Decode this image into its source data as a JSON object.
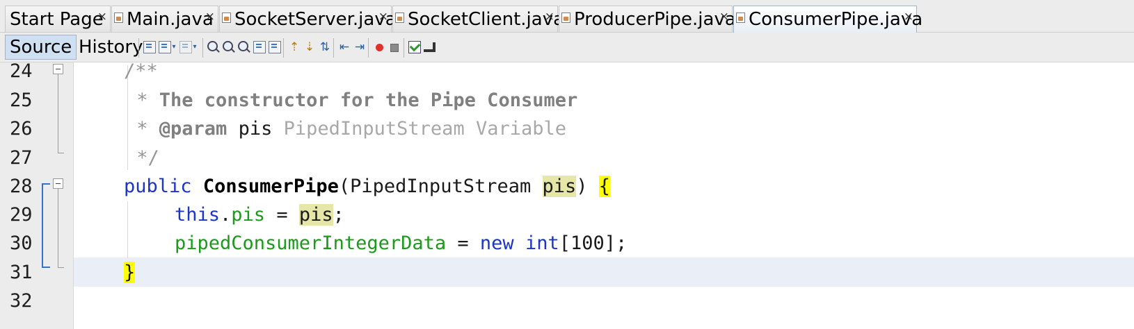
{
  "tabs": [
    {
      "label": "Start Page",
      "has_icon": false,
      "active": false
    },
    {
      "label": "Main.java",
      "has_icon": true,
      "active": false
    },
    {
      "label": "SocketServer.java",
      "has_icon": true,
      "active": false
    },
    {
      "label": "SocketClient.java",
      "has_icon": true,
      "active": false
    },
    {
      "label": "ProducerPipe.java",
      "has_icon": true,
      "active": false
    },
    {
      "label": "ConsumerPipe.java",
      "has_icon": true,
      "active": true
    }
  ],
  "close_glyph": "×",
  "editor_toolbar": {
    "source_label": "Source",
    "history_label": "History"
  },
  "line_numbers": [
    "24",
    "25",
    "26",
    "27",
    "28",
    "29",
    "30",
    "31",
    "32"
  ],
  "code": {
    "l24": "/**",
    "l25_star": " * ",
    "l25_text": "The constructor for the Pipe Consumer",
    "l26_star": " * ",
    "l26_tag": "@param",
    "l26_name": " pis ",
    "l26_desc": "PipedInputStream Variable",
    "l27": " */",
    "l28_kw": "public",
    "l28_sp": " ",
    "l28_name": "ConsumerPipe",
    "l28_open": "(PipedInputStream ",
    "l28_param": "pis",
    "l28_close": ") ",
    "l28_brace": "{",
    "l29_this": "this",
    "l29_dot": ".",
    "l29_field": "pis",
    "l29_eq": " = ",
    "l29_param": "pis",
    "l29_semi": ";",
    "l30_field": "pipedConsumerIntegerData",
    "l30_eq": " = ",
    "l30_new": "new",
    "l30_sp": " ",
    "l30_int": "int",
    "l30_rest": "[100];",
    "l31_brace": "}"
  },
  "colors": {
    "keyword": "#1d34c8",
    "field": "#1b9a1b",
    "comment": "#969696",
    "occurrence_mark": "#e6e6a8",
    "brace_match": "#ffff00",
    "current_line": "#e9eef7"
  }
}
